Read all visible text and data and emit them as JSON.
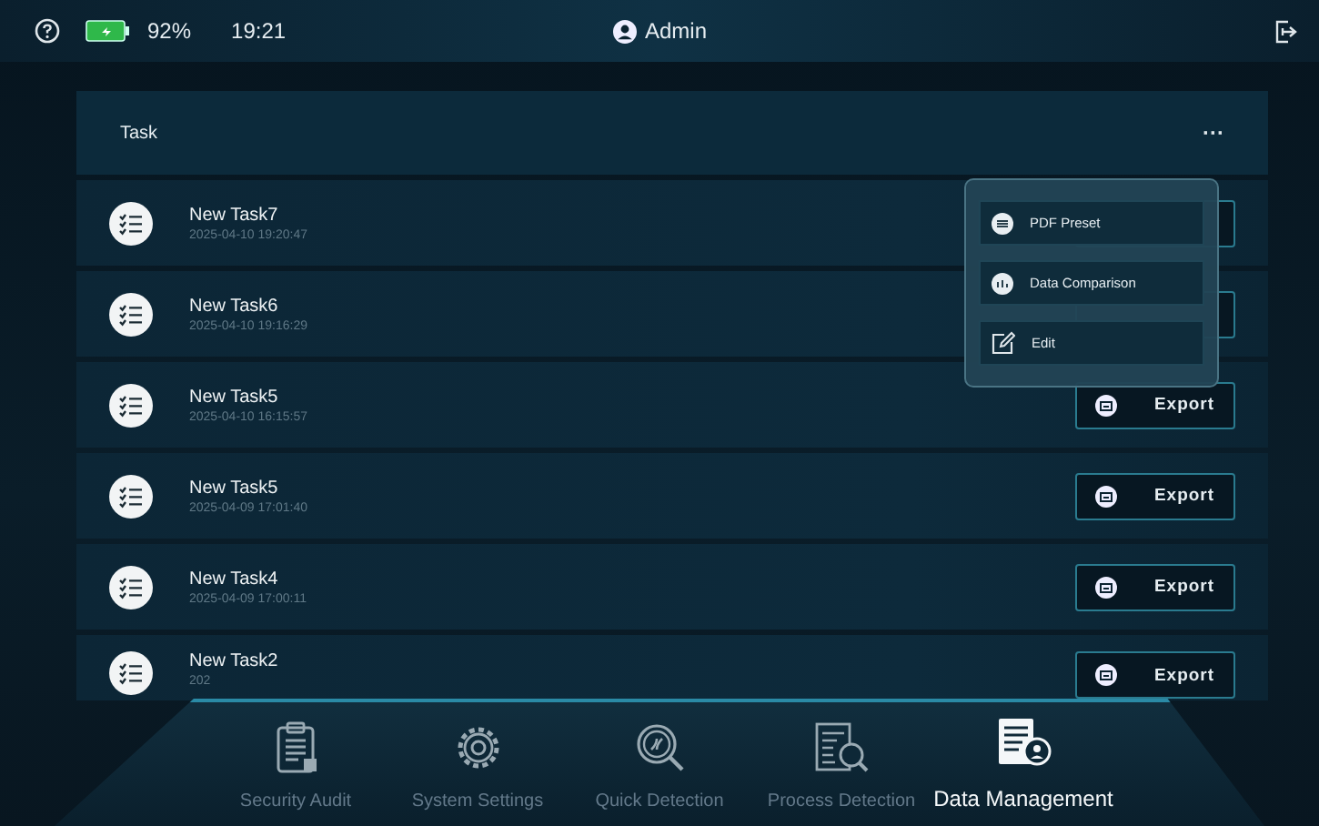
{
  "status_bar": {
    "battery": "92%",
    "time": "19:21",
    "user": "Admin"
  },
  "panel": {
    "title": "Task",
    "more": "···"
  },
  "tasks": [
    {
      "name": "New Task7",
      "date": "2025-04-10 19:20:47"
    },
    {
      "name": "New Task6",
      "date": "2025-04-10 19:16:29"
    },
    {
      "name": "New Task5",
      "date": "2025-04-10 16:15:57",
      "export": "Export"
    },
    {
      "name": "New Task5",
      "date": "2025-04-09 17:01:40",
      "export": "Export"
    },
    {
      "name": "New Task4",
      "date": "2025-04-09 17:00:11",
      "export": "Export"
    },
    {
      "name": "New Task2",
      "date": "202",
      "export": "Export"
    }
  ],
  "menu": [
    {
      "label": "PDF Preset",
      "kind": "pdf"
    },
    {
      "label": "Data Comparison",
      "kind": "compare"
    },
    {
      "label": "Edit",
      "kind": "edit"
    }
  ],
  "nav": [
    {
      "label": "Security Audit",
      "kind": "audit",
      "selected": false
    },
    {
      "label": "System Settings",
      "kind": "settings",
      "selected": false
    },
    {
      "label": "Quick Detection",
      "kind": "quick",
      "selected": false
    },
    {
      "label": "Process Detection",
      "kind": "process",
      "selected": false
    },
    {
      "label": "Data Management",
      "kind": "data",
      "selected": true
    }
  ]
}
